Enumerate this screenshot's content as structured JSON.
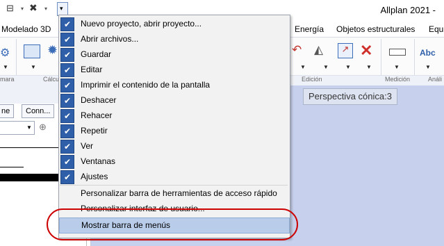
{
  "app_title": "Allplan 2021 -",
  "quick_access": {
    "icons": [
      "layer-selection-icon",
      "tools-icon",
      "customize-toolbar-icon"
    ]
  },
  "ribbon_tabs": [
    "Modelado 3D",
    "Energía",
    "Objetos estructurales",
    "Equi"
  ],
  "ribbon_groups": [
    "mara",
    "Cálcu",
    "Edición",
    "Medición",
    "Análi"
  ],
  "ribbon_text_icon": "Abc",
  "left_panel": {
    "tabs": [
      "ne",
      "Conn..."
    ]
  },
  "viewport_label": "Perspectiva cónica:3",
  "menu": {
    "checked_items": [
      "Nuevo proyecto, abrir proyecto...",
      "Abrir archivos...",
      "Guardar",
      "Editar",
      "Imprimir el contenido de la pantalla",
      "Deshacer",
      "Rehacer",
      "Repetir",
      "Ver",
      "Ventanas",
      "Ajustes"
    ],
    "actions": [
      "Personalizar barra de herramientas de acceso rápido",
      "Personalizar interfaz de usuario...",
      "Mostrar barra de menús"
    ]
  },
  "colors": {
    "checkbox": "#2e5fa8",
    "highlight": "#b9cdea",
    "annotation": "#cc0000",
    "viewport": "#c7d0ec"
  }
}
